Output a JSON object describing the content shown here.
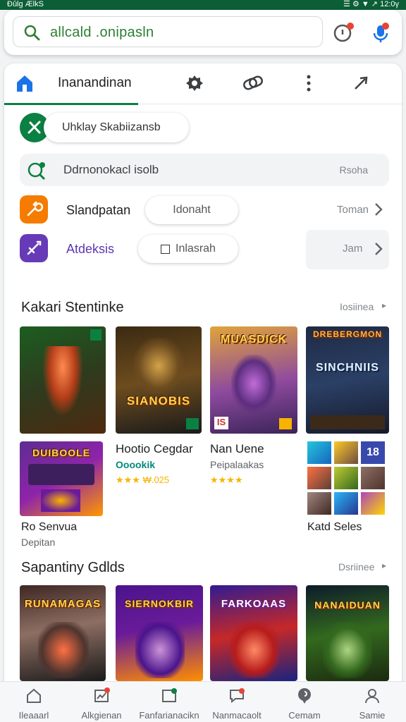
{
  "status": {
    "left": "Đûlg ÆlkS",
    "right": "☰ ⚙ ▼ ↗ 12:0γ"
  },
  "search": {
    "text": "allcald .onipasln"
  },
  "tabs": [
    {
      "icon": "home-icon",
      "label": "Inanandinan"
    },
    {
      "icon": "settings-icon"
    },
    {
      "icon": "link-icon"
    },
    {
      "icon": "more-vertical-icon"
    },
    {
      "icon": "share-icon"
    }
  ],
  "chip": {
    "label": "Uhklay Skabiizansb"
  },
  "info_row": {
    "text": "Ddrnonokacl isolb",
    "action": "Rsoha"
  },
  "settings_rows": [
    {
      "icon": "wrench-icon",
      "label": "Slandpatan",
      "pill": "Idonaht",
      "trail": "Toman"
    },
    {
      "icon": "sword-icon",
      "label": "Atdeksis",
      "pill": "Inlasrah",
      "trail": "Jam"
    }
  ],
  "section1": {
    "title": "Kakari Stentinke",
    "more": "Iosiinea"
  },
  "tiles_row1": [
    "",
    "SIANOBIS",
    "MUASDICK",
    "SINCHNIIS"
  ],
  "badge_tile2": "",
  "tile_badge3": "IS",
  "tile4_top": "DREBERGMON",
  "apps_row2": [
    {
      "title": "Hootio Cegdar",
      "sub": "Ooookik",
      "rating": "★★★ ₩.025"
    },
    {
      "title": "Nan Uene",
      "sub": "Peipalaakas",
      "rating": "★★★★"
    }
  ],
  "tile5_title": "DUIBOOLE",
  "caption_left": {
    "title": "Ro Senvua",
    "sub": "Depitan"
  },
  "caption_right": {
    "title": "Katd Seles"
  },
  "tile_grid_badge": "18",
  "section2": {
    "title": "Sapantiny Gdlds",
    "more": "Dsriinee"
  },
  "tiles_row3": [
    "RUNAMAGAS",
    "SIERNOKBIR",
    "FARKOAAS",
    "NANAIDUAN"
  ],
  "bottom_nav": [
    {
      "icon": "home-icon",
      "label": "Ileaaarl"
    },
    {
      "icon": "chart-icon",
      "label": "Alkgienan"
    },
    {
      "icon": "badge-icon",
      "label": "Fanfarianacikn"
    },
    {
      "icon": "chat-icon",
      "label": "Nanmacaolt"
    },
    {
      "icon": "location-icon",
      "label": "Cemam"
    },
    {
      "icon": "person-icon",
      "label": "Samie"
    }
  ],
  "colors": {
    "status_bar": "#0b5e35",
    "accent_green": "#0b8043",
    "tab_home_blue": "#1a73e8",
    "purple": "#673ab7",
    "orange": "#f57c00"
  }
}
